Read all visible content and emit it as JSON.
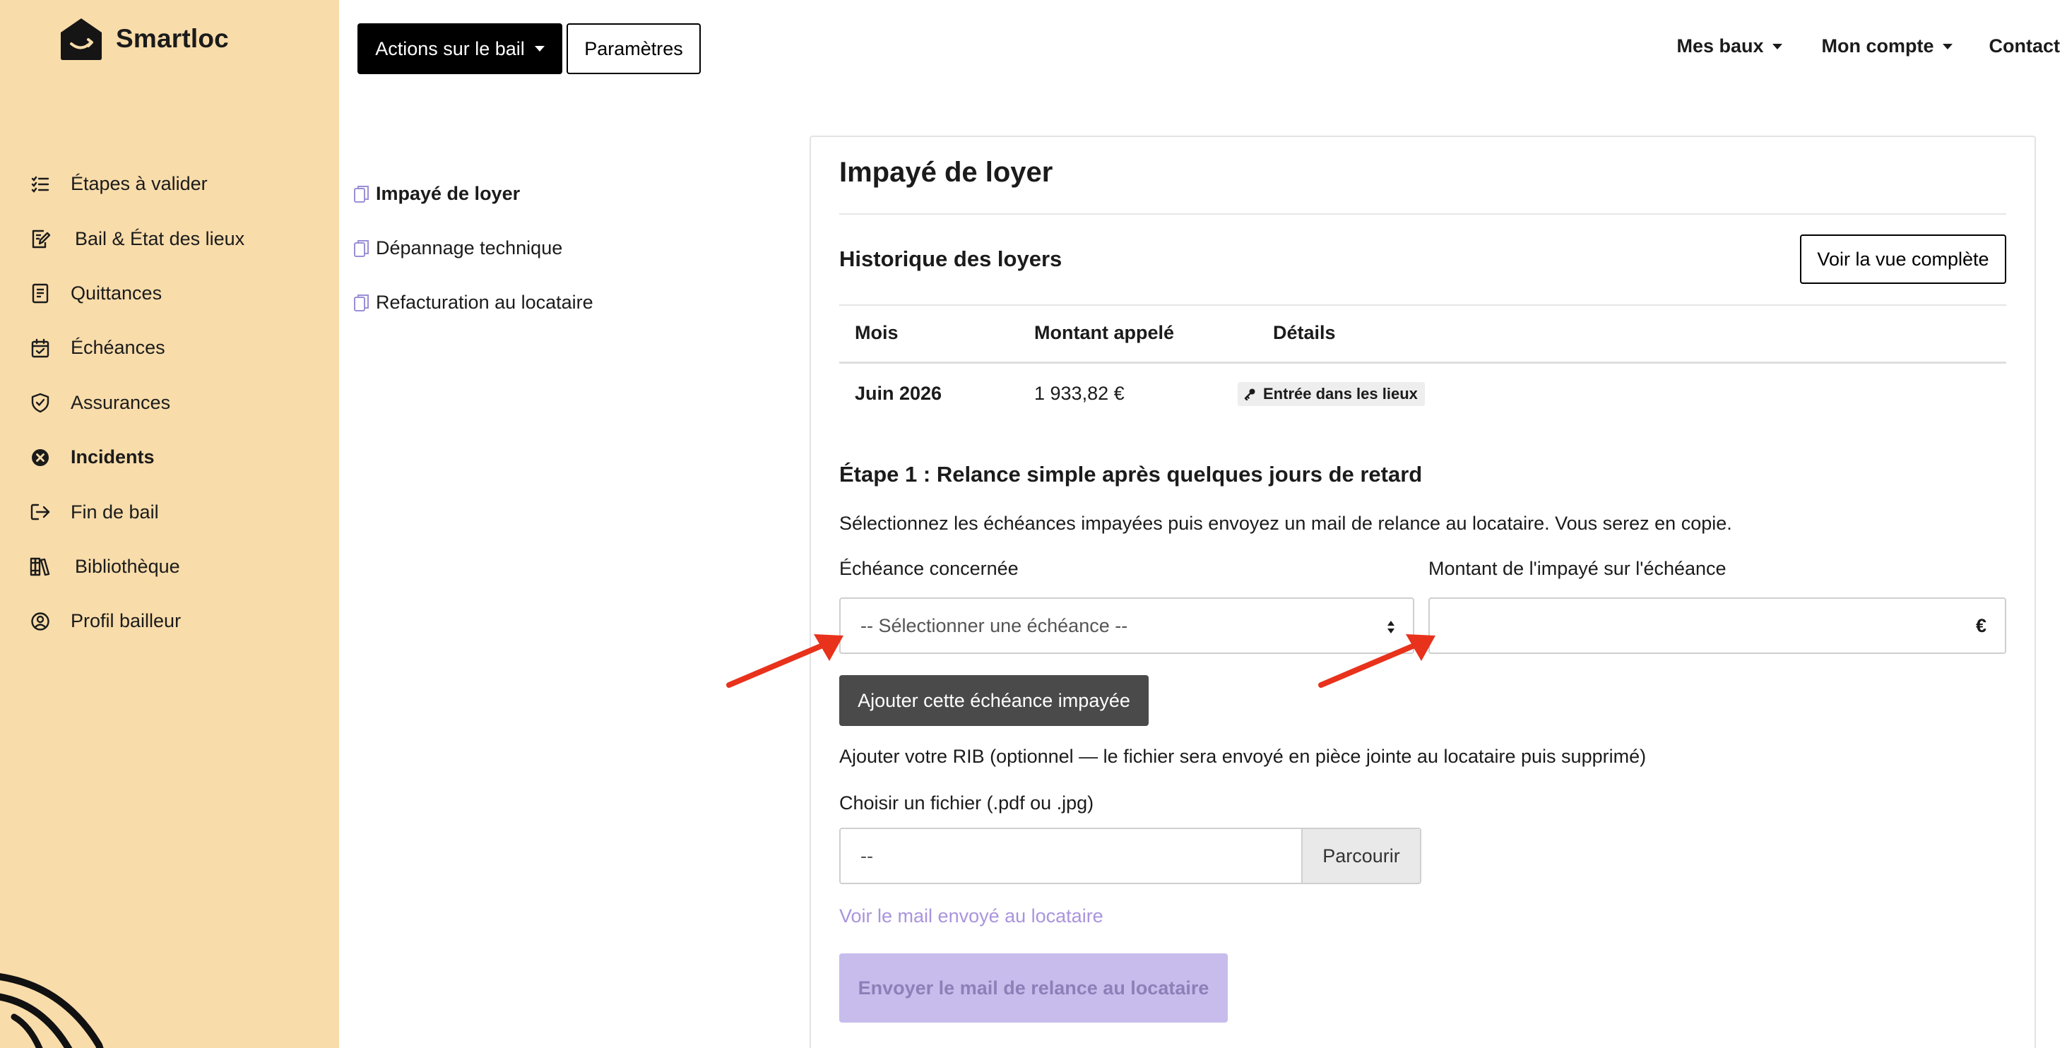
{
  "brand": {
    "name": "Smartloc"
  },
  "sidebar": {
    "items": [
      {
        "label": "Étapes à valider",
        "icon": "checklist-icon"
      },
      {
        "label": "Bail & État des lieux",
        "icon": "document-edit-icon"
      },
      {
        "label": "Quittances",
        "icon": "receipt-icon"
      },
      {
        "label": "Échéances",
        "icon": "calendar-check-icon"
      },
      {
        "label": "Assurances",
        "icon": "shield-check-icon"
      },
      {
        "label": "Incidents",
        "icon": "x-circle-icon",
        "active": true
      },
      {
        "label": "Fin de bail",
        "icon": "exit-icon"
      },
      {
        "label": "Bibliothèque",
        "icon": "books-icon"
      },
      {
        "label": "Profil bailleur",
        "icon": "user-circle-icon"
      }
    ]
  },
  "toolbar": {
    "actions_label": "Actions sur le bail",
    "params_label": "Paramètres"
  },
  "topnav": {
    "leases": "Mes baux",
    "account": "Mon compte",
    "contact": "Contact"
  },
  "subnav": {
    "items": [
      {
        "label": "Impayé de loyer",
        "active": true
      },
      {
        "label": "Dépannage technique"
      },
      {
        "label": "Refacturation au locataire"
      }
    ]
  },
  "main": {
    "title": "Impayé de loyer",
    "history": {
      "title": "Historique des loyers",
      "full_view_label": "Voir la vue complète",
      "columns": [
        "Mois",
        "Montant appelé",
        "Détails"
      ],
      "rows": [
        {
          "month": "Juin 2026",
          "amount": "1 933,82 €",
          "detail": "Entrée dans les lieux",
          "detail_icon": "key-icon"
        }
      ]
    },
    "step": {
      "title": "Étape 1 : Relance simple après quelques jours de retard",
      "description": "Sélectionnez les échéances impayées puis envoyez un mail de relance au locataire. Vous serez en copie.",
      "due_label": "Échéance concernée",
      "due_select_value": "-- Sélectionner une échéance --",
      "amount_label": "Montant de l'impayé sur l'échéance",
      "amount_value": "",
      "amount_unit": "€",
      "add_button": "Ajouter cette échéance impayée",
      "rib_text": "Ajouter votre RIB (optionnel — le fichier sera envoyé en pièce jointe au locataire puis supprimé)",
      "file_label": "Choisir un fichier (.pdf ou .jpg)",
      "file_value": "--",
      "browse_label": "Parcourir",
      "view_mail_link": "Voir le mail envoyé au locataire",
      "send_button": "Envoyer le mail de relance au locataire"
    }
  },
  "colors": {
    "sidebar_bg": "#f8dcaa",
    "primary_button": "#000000",
    "secondary_dark_button": "#4a4a4a",
    "disabled_send_button": "#c8bcec",
    "link": "#a994dd",
    "annotation_arrow": "#e8321c"
  }
}
